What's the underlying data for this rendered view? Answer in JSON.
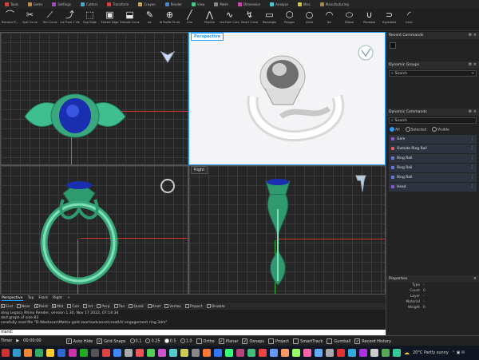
{
  "tabs": [
    {
      "label": "Tools",
      "color": "#c44"
    },
    {
      "label": "Gems",
      "color": "#c84"
    },
    {
      "label": "Settings",
      "color": "#a4c"
    },
    {
      "label": "Cutters",
      "color": "#4ac"
    },
    {
      "label": "Transform",
      "color": "#c44"
    },
    {
      "label": "Crayon",
      "color": "#ca4"
    },
    {
      "label": "Render",
      "color": "#48c"
    },
    {
      "label": "View",
      "color": "#4c8"
    },
    {
      "label": "Mesh",
      "color": "#888"
    },
    {
      "label": "Dimension",
      "color": "#c4a"
    },
    {
      "label": "Analyze",
      "color": "#4cc"
    },
    {
      "label": "Misc",
      "color": "#cc4"
    },
    {
      "label": "Manufacturing",
      "color": "#a84"
    }
  ],
  "toolbar": [
    {
      "label": "Remove Fi...",
      "icon": "⌒"
    },
    {
      "label": "Split Curve",
      "icon": "✂"
    },
    {
      "label": "Trim Curve",
      "icon": "⟋"
    },
    {
      "label": "Curve From 2 Views",
      "icon": "⤴"
    },
    {
      "label": "Dup Edge",
      "icon": "⬚"
    },
    {
      "label": "Extract Edge",
      "icon": "▣"
    },
    {
      "label": "Extrude Curve",
      "icon": "⬓"
    },
    {
      "label": "Jot",
      "icon": "✎"
    },
    {
      "label": "Add Profile To Lib...",
      "icon": "⊕"
    },
    {
      "label": "Line",
      "icon": "╱"
    },
    {
      "label": "Polyline",
      "icon": "⋀"
    },
    {
      "label": "Free-Form Curve",
      "icon": "∿"
    },
    {
      "label": "Smart Curve",
      "icon": "↯"
    },
    {
      "label": "Rectangle",
      "icon": "▭"
    },
    {
      "label": "Polygon",
      "icon": "⬡"
    },
    {
      "label": "Circle",
      "icon": "○"
    },
    {
      "label": "Arc",
      "icon": "◠"
    },
    {
      "label": "Ellipse",
      "icon": "⬭"
    },
    {
      "label": "Parabola",
      "icon": "∪"
    },
    {
      "label": "Hyperbola",
      "icon": "⊃"
    },
    {
      "label": "Conic",
      "icon": "◜"
    }
  ],
  "viewports": {
    "top_left": "",
    "perspective": "Perspective",
    "front": "",
    "right": "Right"
  },
  "view_tabs": [
    "Perspective",
    "Top",
    "Front",
    "Right",
    "+"
  ],
  "osnaps": [
    {
      "label": "End",
      "checked": true
    },
    {
      "label": "Near",
      "checked": false
    },
    {
      "label": "Point",
      "checked": true
    },
    {
      "label": "Mid",
      "checked": true
    },
    {
      "label": "Cen",
      "checked": false
    },
    {
      "label": "Int",
      "checked": false
    },
    {
      "label": "Perp",
      "checked": false
    },
    {
      "label": "Tan",
      "checked": false
    },
    {
      "label": "Quad",
      "checked": false
    },
    {
      "label": "Knot",
      "checked": false
    },
    {
      "label": "Vertex",
      "checked": false
    },
    {
      "label": "Project",
      "checked": false
    },
    {
      "label": "Disable",
      "checked": false
    }
  ],
  "command_history": [
    "ding Legacy Rhino Render, version 1.30, Nov 17 2022, 07:14:34",
    "ded graph of size 83",
    "cessfully read file \"D:\\Nastaran\\Matrix gold zoom\\advance\\creatUV engagement ring.3dm\""
  ],
  "command_prompt": "mand:",
  "panel": {
    "recent_title": "Recent Commands",
    "groups_title": "Dynamic Groups",
    "groups_search": "Search",
    "commands_title": "Dynamic Commands",
    "commands_search": "Search",
    "filter_options": [
      "All",
      "Selected",
      "Visible"
    ],
    "items": [
      {
        "label": "Gem",
        "color": "#8a5bd8"
      },
      {
        "label": "Outside Ring Rail",
        "color": "#e06060"
      },
      {
        "label": "Ring Rail",
        "color": "#6a7ae0"
      },
      {
        "label": "Ring Rail",
        "color": "#6a7ae0"
      },
      {
        "label": "Ring Rail",
        "color": "#6a7ae0"
      },
      {
        "label": "Head",
        "color": "#8a5bd8"
      }
    ],
    "props_title": "Properties",
    "props": [
      {
        "key": "Type",
        "value": "-"
      },
      {
        "key": "Count",
        "value": "0"
      },
      {
        "key": "Layer",
        "value": "-"
      },
      {
        "key": "Material",
        "value": "-"
      },
      {
        "key": "Weight",
        "value": "0"
      }
    ]
  },
  "status": {
    "timer_label": "Timer",
    "timer_value": "00:00:00",
    "auto_hide": "Auto Hide",
    "grid_snaps": "Grid Snaps",
    "snap_values": [
      "0.1",
      "0.25",
      "0.5",
      "1.0"
    ],
    "ortho": "Ortho",
    "planar": "Planar",
    "osnaps": "Osnaps",
    "project": "Project",
    "smarttrack": "SmartTrack",
    "gumball": "Gumball",
    "record_history": "Record History"
  },
  "taskbar": {
    "weather": "20°C  Partly sunny"
  }
}
